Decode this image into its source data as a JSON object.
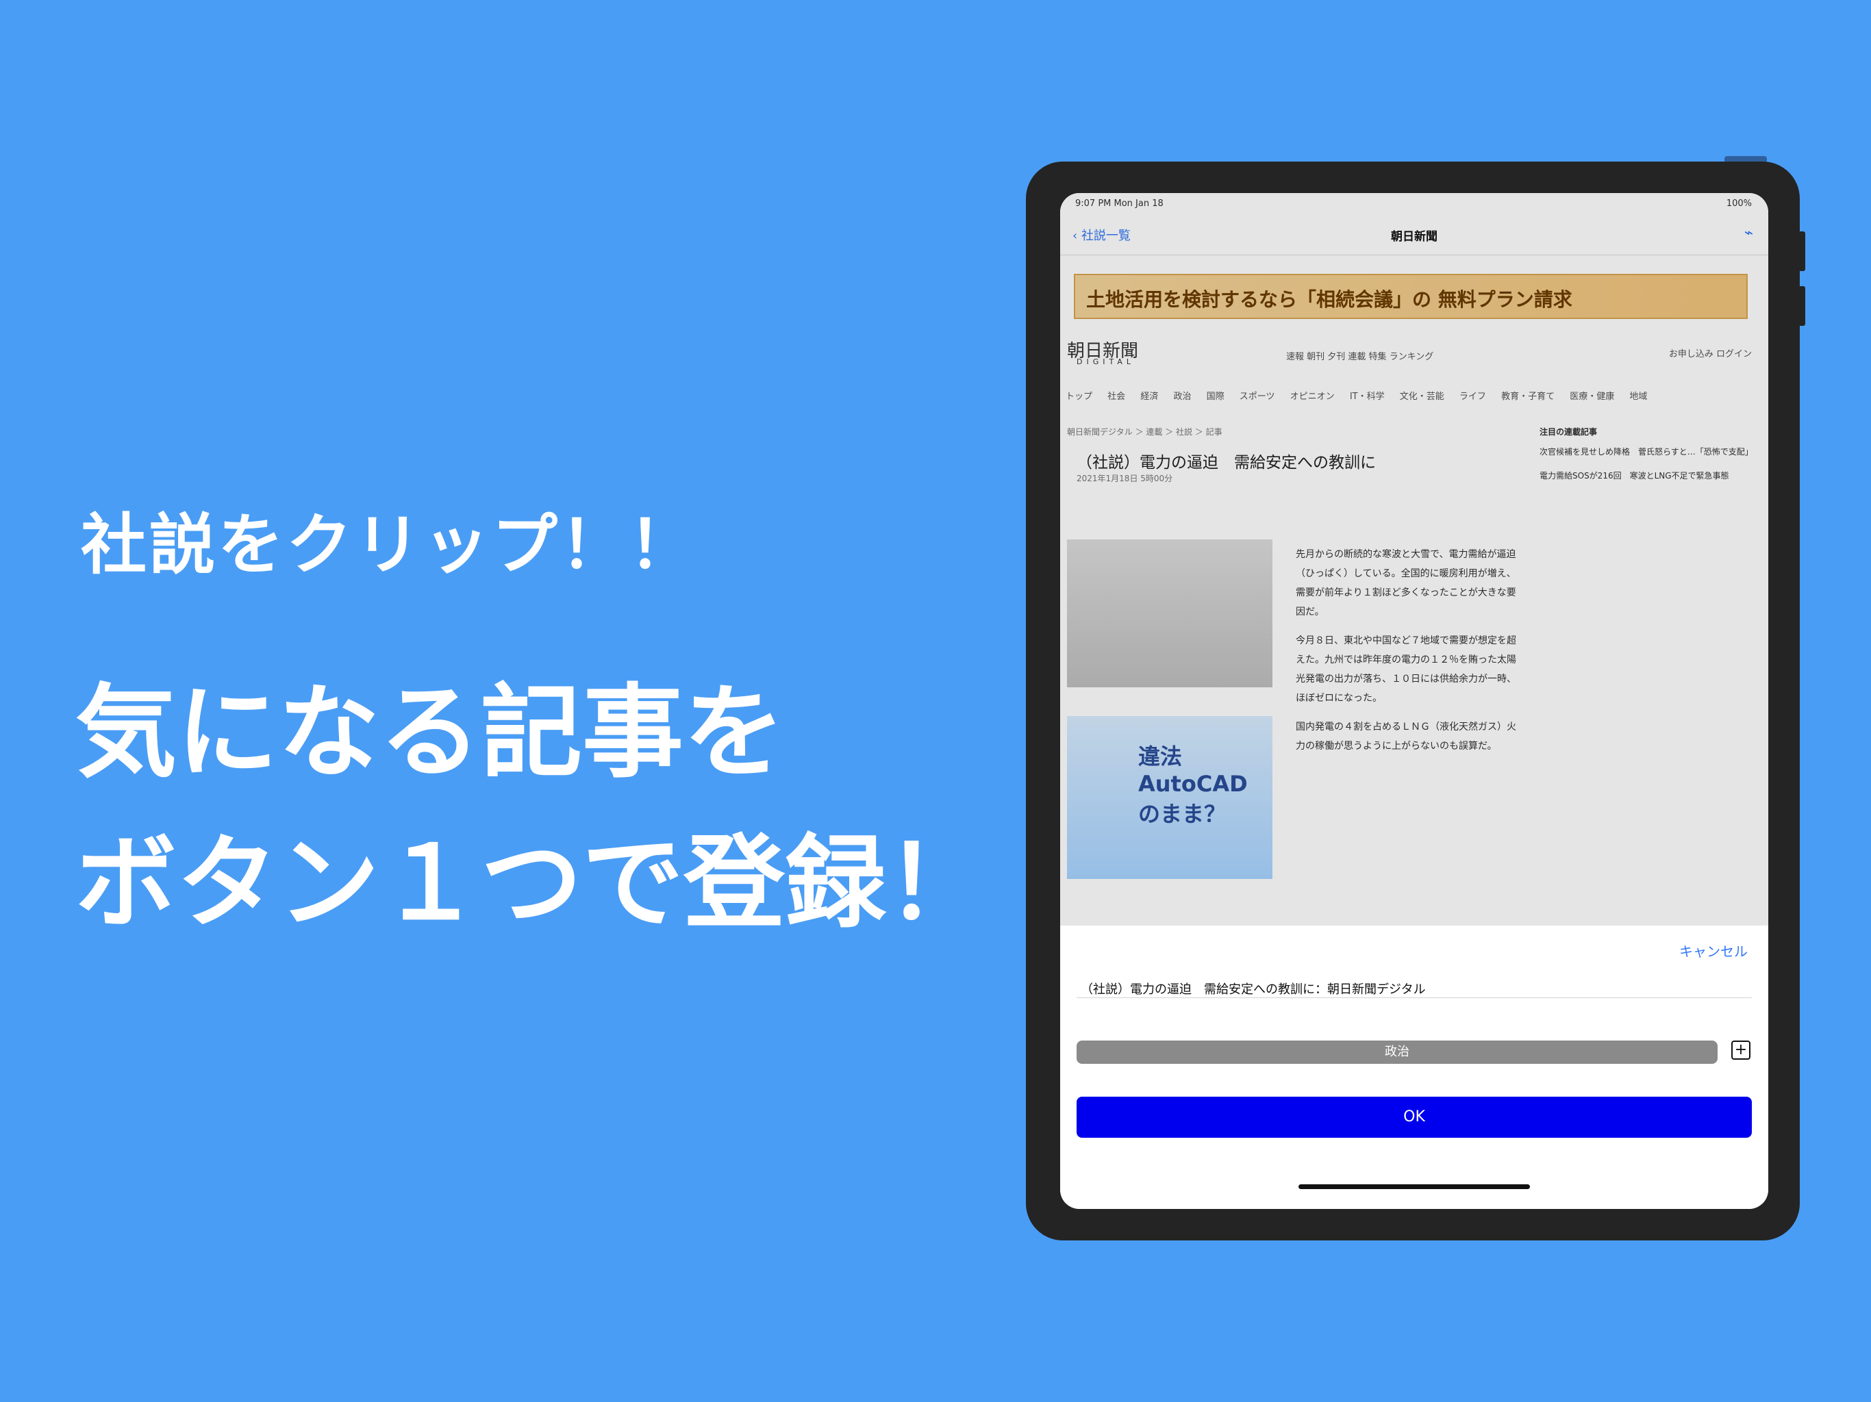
{
  "promo": {
    "line1": "社説をクリップ！！",
    "line2": "気になる記事を",
    "line3": "ボタン１つで登録！"
  },
  "status_bar": {
    "time": "9:07 PM  Mon Jan 18",
    "battery": "100%"
  },
  "navigation": {
    "back_label": "社説一覧",
    "title": "朝日新聞",
    "clip_icon": "paperclip-icon"
  },
  "background_page": {
    "ad_text": "土地活用を検討するなら「相続会議」の 無料プラン請求",
    "logo": "朝日新聞",
    "logo_sub": "DIGITAL",
    "top_links": "速報  朝刊  夕刊  連載  特集  ランキング",
    "login": "お申し込み  ログイン",
    "menu": [
      "トップ",
      "社会",
      "経済",
      "政治",
      "国際",
      "スポーツ",
      "オピニオン",
      "IT・科学",
      "文化・芸能",
      "ライフ",
      "教育・子育て",
      "医療・健康",
      "地域"
    ],
    "breadcrumb": "朝日新聞デジタル ＞ 連載 ＞ 社説 ＞ 記事",
    "headline": "（社説）電力の逼迫　需給安定への教訓に",
    "date": "2021年1月18日 5時00分",
    "body_paragraphs": [
      "先月からの断続的な寒波と大雪で、電力需給が逼迫（ひっぱく）している。全国的に暖房利用が増え、需要が前年より１割ほど多くなったことが大きな要因だ。",
      "今月８日、東北や中国など７地域で需要が想定を超えた。九州では昨年度の電力の１２％を賄った太陽光発電の出力が落ち、１０日には供給余力が一時、ほぼゼロになった。",
      "国内発電の４割を占めるＬＮＧ（液化天然ガス）火力の稼働が思うように上がらないのも誤算だ。"
    ],
    "right_column_title": "注目の連載記事",
    "right_items": [
      "次官候補を見せしめ降格　菅氏怒らすと…「恐怖で支配」",
      "電力需給SOSが216回　寒波とLNG不足で緊急事態"
    ],
    "ad2_text": "違法 AutoCAD のまま？"
  },
  "sheet": {
    "cancel_label": "キャンセル",
    "title_value": "（社説）電力の逼迫　需給安定への教訓に：朝日新聞デジタル",
    "category_label": "政治",
    "add_icon": "plus-square-icon",
    "ok_label": "OK"
  }
}
